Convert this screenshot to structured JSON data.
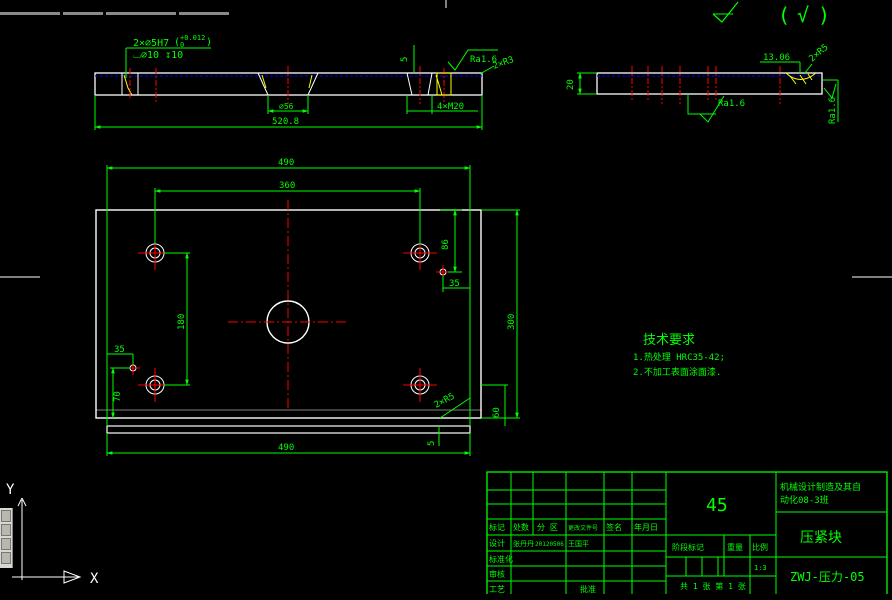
{
  "colors": {
    "background": "#000000",
    "outline": "#ffffff",
    "dimension": "#00ff00",
    "centerline": "#ff0000",
    "hidden_line": "#0000ff",
    "hatch": "#ffff00",
    "title_block": "#00ff00",
    "ucs": "#ffffff"
  },
  "top_right": {
    "roughness_remark": "(",
    "roughness_check": "√",
    "roughness_close": ")"
  },
  "section_view": {
    "callout_holes": "2×⌀5H7",
    "tolerance_upper": "+0.012",
    "tolerance_lower": "0",
    "tolerance_open": "(",
    "tolerance_close": ")",
    "callout_depth": "⌴⌀10 ↧10",
    "dim_thickness": "5",
    "roughness": "Ra1.6",
    "chamfer": "2×R3",
    "dim_counterbore": "⌀56",
    "thread": "4×M20",
    "overall_length": "520.8"
  },
  "side_view": {
    "dim_width": "13.06",
    "chamfer": "2×R5",
    "height": "20",
    "roughness": "Ra1.6",
    "roughness_vertical": "Ra1.6"
  },
  "plan_view": {
    "width_top": "490",
    "hole_spacing": "360",
    "dim_86": "86",
    "dim_35_right": "35",
    "dim_180": "180",
    "dim_300": "300",
    "dim_35_left": "35",
    "dim_70": "70",
    "fillet": "2×R5",
    "dim_60": "60",
    "dim_5": "5",
    "width_bottom": "490"
  },
  "notes": {
    "title": "技术要求",
    "items": [
      "1.热处理 HRC35-42;",
      "2.不加工表面涂面漆."
    ]
  },
  "title_block": {
    "material": "45",
    "school": "机械设计制造及其自",
    "class": "动化08-3班",
    "part_name": "压紧块",
    "drawing_no": "ZWJ-压力-05",
    "headers": [
      "标记",
      "处数",
      "分 区",
      "更改文件号",
      "签名",
      "年月日"
    ],
    "rows": [
      "设计",
      "标准化",
      "审核",
      "工艺"
    ],
    "designer": "张丹丹",
    "date": "20120506",
    "reviewer": "王国平",
    "stage_mark": "阶段标记",
    "weight": "重量",
    "scale": "比例",
    "scale_value": "1:3",
    "sheets": "共 1 张 第 1 张",
    "approve": "批准"
  },
  "ucs": {
    "x_label": "X",
    "y_label": "Y"
  }
}
